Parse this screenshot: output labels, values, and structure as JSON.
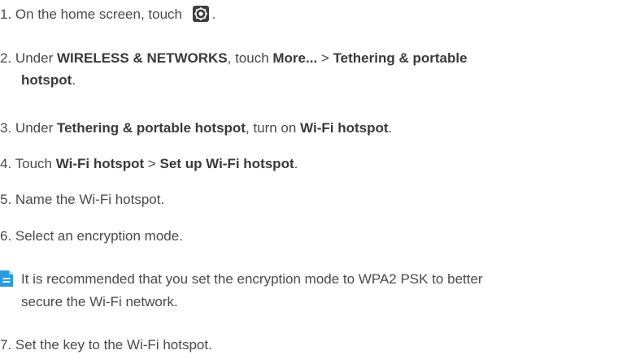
{
  "steps": [
    {
      "num": "1.",
      "parts": [
        "On the home screen, touch",
        "."
      ]
    },
    {
      "num": "2.",
      "parts": [
        "Under ",
        "WIRELESS & NETWORKS",
        ", touch ",
        "More...",
        " > ",
        "Tethering & portable",
        "hotspot",
        "."
      ]
    },
    {
      "num": "3.",
      "parts": [
        "Under ",
        "Tethering & portable hotspot",
        ", turn on ",
        "Wi-Fi hotspot",
        "."
      ]
    },
    {
      "num": "4.",
      "parts": [
        "Touch ",
        "Wi-Fi hotspot",
        " > ",
        "Set up Wi-Fi hotspot",
        "."
      ]
    },
    {
      "num": "5.",
      "text": "Name the Wi-Fi hotspot."
    },
    {
      "num": "6.",
      "text": "Select an encryption mode."
    },
    {
      "num": "7.",
      "text": "Set the key to the Wi-Fi hotspot."
    }
  ],
  "note": {
    "icon": "note-icon",
    "line1": "It is recommended that you set the encryption mode to WPA2 PSK to better",
    "line2": "secure the Wi-Fi network."
  },
  "icons": {
    "settings": "settings-gear-icon"
  },
  "colors": {
    "text": "#4a4a4a",
    "note_icon": "#2b9be0"
  }
}
